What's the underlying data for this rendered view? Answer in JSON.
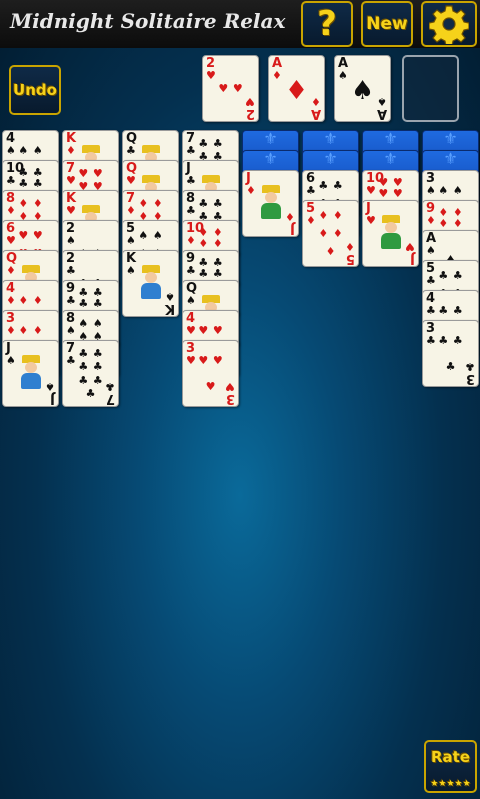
{
  "header": {
    "title": "Midnight Solitaire Relax",
    "help_label": "?",
    "new_label": "New",
    "settings_icon": "gear-icon"
  },
  "undo_label": "Undo",
  "rate": {
    "label": "Rate",
    "stars": "★★★★★"
  },
  "colors": {
    "accent": "#f6d21a",
    "border": "#c9a400",
    "red": "#d81a1a",
    "black": "#111111"
  },
  "foundations": [
    {
      "rank": "2",
      "suit": "♥",
      "color": "red"
    },
    {
      "rank": "A",
      "suit": "♦",
      "color": "red"
    },
    {
      "rank": "A",
      "suit": "♠",
      "color": "black"
    },
    {
      "empty": true
    }
  ],
  "tableau": [
    {
      "face_down": 0,
      "cards": [
        {
          "rank": "4",
          "suit": "♠",
          "color": "black"
        },
        {
          "rank": "10",
          "suit": "♣",
          "color": "black"
        },
        {
          "rank": "8",
          "suit": "♦",
          "color": "red"
        },
        {
          "rank": "6",
          "suit": "♥",
          "color": "red"
        },
        {
          "rank": "Q",
          "suit": "♦",
          "color": "red"
        },
        {
          "rank": "4",
          "suit": "♦",
          "color": "red"
        },
        {
          "rank": "3",
          "suit": "♦",
          "color": "red"
        },
        {
          "rank": "J",
          "suit": "♠",
          "color": "black"
        }
      ]
    },
    {
      "face_down": 0,
      "cards": [
        {
          "rank": "K",
          "suit": "♦",
          "color": "red"
        },
        {
          "rank": "7",
          "suit": "♥",
          "color": "red"
        },
        {
          "rank": "K",
          "suit": "♥",
          "color": "red"
        },
        {
          "rank": "2",
          "suit": "♠",
          "color": "black"
        },
        {
          "rank": "2",
          "suit": "♣",
          "color": "black"
        },
        {
          "rank": "9",
          "suit": "♣",
          "color": "black"
        },
        {
          "rank": "8",
          "suit": "♠",
          "color": "black"
        },
        {
          "rank": "7",
          "suit": "♣",
          "color": "black"
        }
      ]
    },
    {
      "face_down": 0,
      "cards": [
        {
          "rank": "Q",
          "suit": "♣",
          "color": "black"
        },
        {
          "rank": "Q",
          "suit": "♥",
          "color": "red"
        },
        {
          "rank": "7",
          "suit": "♦",
          "color": "red"
        },
        {
          "rank": "5",
          "suit": "♠",
          "color": "black"
        },
        {
          "rank": "K",
          "suit": "♠",
          "color": "black"
        }
      ]
    },
    {
      "face_down": 0,
      "cards": [
        {
          "rank": "7",
          "suit": "♣",
          "color": "black"
        },
        {
          "rank": "J",
          "suit": "♣",
          "color": "black"
        },
        {
          "rank": "8",
          "suit": "♣",
          "color": "black"
        },
        {
          "rank": "10",
          "suit": "♦",
          "color": "red"
        },
        {
          "rank": "9",
          "suit": "♣",
          "color": "black"
        },
        {
          "rank": "Q",
          "suit": "♠",
          "color": "black"
        },
        {
          "rank": "4",
          "suit": "♥",
          "color": "red"
        },
        {
          "rank": "3",
          "suit": "♥",
          "color": "red"
        }
      ]
    },
    {
      "face_down": 2,
      "cards": [
        {
          "rank": "J",
          "suit": "♦",
          "color": "red"
        }
      ]
    },
    {
      "face_down": 2,
      "cards": [
        {
          "rank": "6",
          "suit": "♣",
          "color": "black"
        },
        {
          "rank": "5",
          "suit": "♦",
          "color": "red"
        }
      ]
    },
    {
      "face_down": 2,
      "cards": [
        {
          "rank": "10",
          "suit": "♥",
          "color": "red"
        },
        {
          "rank": "J",
          "suit": "♥",
          "color": "red"
        }
      ]
    },
    {
      "face_down": 2,
      "cards": [
        {
          "rank": "3",
          "suit": "♠",
          "color": "black"
        },
        {
          "rank": "9",
          "suit": "♦",
          "color": "red"
        },
        {
          "rank": "A",
          "suit": "♠",
          "color": "black"
        },
        {
          "rank": "5",
          "suit": "♣",
          "color": "black"
        },
        {
          "rank": "4",
          "suit": "♣",
          "color": "black"
        },
        {
          "rank": "3",
          "suit": "♣",
          "color": "black"
        }
      ]
    }
  ]
}
